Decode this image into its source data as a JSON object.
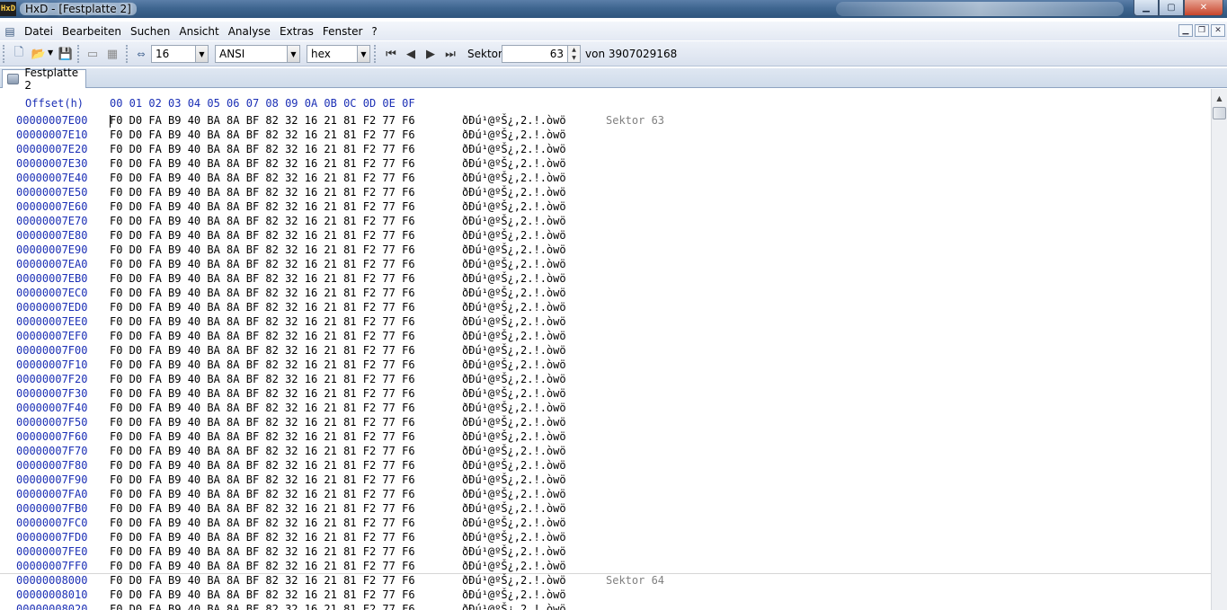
{
  "window": {
    "title": "HxD - [Festplatte 2]",
    "app_icon_text": "HxD"
  },
  "menu": {
    "items": [
      "Datei",
      "Bearbeiten",
      "Suchen",
      "Ansicht",
      "Analyse",
      "Extras",
      "Fenster",
      "?"
    ]
  },
  "toolbar": {
    "bytes_per_row": "16",
    "charset": "ANSI",
    "offset_base": "hex",
    "sector_label": "Sektor",
    "sector_value": "63",
    "sector_total": "von 3907029168"
  },
  "tabs": [
    {
      "label": "Festplatte 2"
    }
  ],
  "editor": {
    "offset_header": "Offset(h)",
    "column_header": "00 01 02 03 04 05 06 07 08 09 0A 0B 0C 0D 0E 0F",
    "hex_pattern": "F0 D0 FA B9 40 BA 8A BF 82 32 16 21 81 F2 77 F6",
    "ascii_pattern": "ðÐú¹@º­Š¿‚2.!.òwö",
    "rows": [
      {
        "offset": "00000007E00",
        "sector": "Sektor 63"
      },
      {
        "offset": "00000007E10"
      },
      {
        "offset": "00000007E20"
      },
      {
        "offset": "00000007E30"
      },
      {
        "offset": "00000007E40"
      },
      {
        "offset": "00000007E50"
      },
      {
        "offset": "00000007E60"
      },
      {
        "offset": "00000007E70"
      },
      {
        "offset": "00000007E80"
      },
      {
        "offset": "00000007E90"
      },
      {
        "offset": "00000007EA0"
      },
      {
        "offset": "00000007EB0"
      },
      {
        "offset": "00000007EC0"
      },
      {
        "offset": "00000007ED0"
      },
      {
        "offset": "00000007EE0"
      },
      {
        "offset": "00000007EF0"
      },
      {
        "offset": "00000007F00"
      },
      {
        "offset": "00000007F10"
      },
      {
        "offset": "00000007F20"
      },
      {
        "offset": "00000007F30"
      },
      {
        "offset": "00000007F40"
      },
      {
        "offset": "00000007F50"
      },
      {
        "offset": "00000007F60"
      },
      {
        "offset": "00000007F70"
      },
      {
        "offset": "00000007F80"
      },
      {
        "offset": "00000007F90"
      },
      {
        "offset": "00000007FA0"
      },
      {
        "offset": "00000007FB0"
      },
      {
        "offset": "00000007FC0"
      },
      {
        "offset": "00000007FD0"
      },
      {
        "offset": "00000007FE0"
      },
      {
        "offset": "00000007FF0"
      },
      {
        "offset": "00000008000",
        "sector": "Sektor 64"
      },
      {
        "offset": "00000008010"
      },
      {
        "offset": "00000008020"
      }
    ]
  }
}
